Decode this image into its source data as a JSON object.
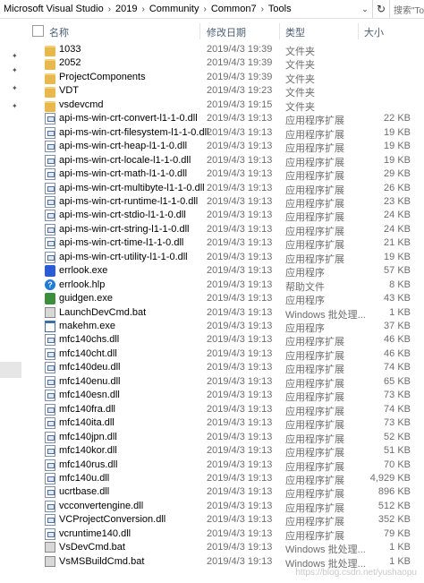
{
  "breadcrumb": [
    "Microsoft Visual Studio",
    "2019",
    "Community",
    "Common7",
    "Tools"
  ],
  "search": {
    "placeholder": "搜索\"To"
  },
  "columns": {
    "name": "名称",
    "date": "修改日期",
    "type": "类型",
    "size": "大小"
  },
  "files": [
    {
      "name": "1033",
      "date": "2019/4/3 19:39",
      "type": "文件夹",
      "size": "",
      "icon": "folder"
    },
    {
      "name": "2052",
      "date": "2019/4/3 19:39",
      "type": "文件夹",
      "size": "",
      "icon": "folder"
    },
    {
      "name": "ProjectComponents",
      "date": "2019/4/3 19:39",
      "type": "文件夹",
      "size": "",
      "icon": "folder"
    },
    {
      "name": "VDT",
      "date": "2019/4/3 19:23",
      "type": "文件夹",
      "size": "",
      "icon": "folder"
    },
    {
      "name": "vsdevcmd",
      "date": "2019/4/3 19:15",
      "type": "文件夹",
      "size": "",
      "icon": "folder"
    },
    {
      "name": "api-ms-win-crt-convert-l1-1-0.dll",
      "date": "2019/4/3 19:13",
      "type": "应用程序扩展",
      "size": "22 KB",
      "icon": "dll"
    },
    {
      "name": "api-ms-win-crt-filesystem-l1-1-0.dll",
      "date": "2019/4/3 19:13",
      "type": "应用程序扩展",
      "size": "19 KB",
      "icon": "dll"
    },
    {
      "name": "api-ms-win-crt-heap-l1-1-0.dll",
      "date": "2019/4/3 19:13",
      "type": "应用程序扩展",
      "size": "19 KB",
      "icon": "dll"
    },
    {
      "name": "api-ms-win-crt-locale-l1-1-0.dll",
      "date": "2019/4/3 19:13",
      "type": "应用程序扩展",
      "size": "19 KB",
      "icon": "dll"
    },
    {
      "name": "api-ms-win-crt-math-l1-1-0.dll",
      "date": "2019/4/3 19:13",
      "type": "应用程序扩展",
      "size": "29 KB",
      "icon": "dll"
    },
    {
      "name": "api-ms-win-crt-multibyte-l1-1-0.dll",
      "date": "2019/4/3 19:13",
      "type": "应用程序扩展",
      "size": "26 KB",
      "icon": "dll"
    },
    {
      "name": "api-ms-win-crt-runtime-l1-1-0.dll",
      "date": "2019/4/3 19:13",
      "type": "应用程序扩展",
      "size": "23 KB",
      "icon": "dll"
    },
    {
      "name": "api-ms-win-crt-stdio-l1-1-0.dll",
      "date": "2019/4/3 19:13",
      "type": "应用程序扩展",
      "size": "24 KB",
      "icon": "dll"
    },
    {
      "name": "api-ms-win-crt-string-l1-1-0.dll",
      "date": "2019/4/3 19:13",
      "type": "应用程序扩展",
      "size": "24 KB",
      "icon": "dll"
    },
    {
      "name": "api-ms-win-crt-time-l1-1-0.dll",
      "date": "2019/4/3 19:13",
      "type": "应用程序扩展",
      "size": "21 KB",
      "icon": "dll"
    },
    {
      "name": "api-ms-win-crt-utility-l1-1-0.dll",
      "date": "2019/4/3 19:13",
      "type": "应用程序扩展",
      "size": "19 KB",
      "icon": "dll"
    },
    {
      "name": "errlook.exe",
      "date": "2019/4/3 19:13",
      "type": "应用程序",
      "size": "57 KB",
      "icon": "exe-blue"
    },
    {
      "name": "errlook.hlp",
      "date": "2019/4/3 19:13",
      "type": "帮助文件",
      "size": "8 KB",
      "icon": "help"
    },
    {
      "name": "guidgen.exe",
      "date": "2019/4/3 19:13",
      "type": "应用程序",
      "size": "43 KB",
      "icon": "guid"
    },
    {
      "name": "LaunchDevCmd.bat",
      "date": "2019/4/3 19:13",
      "type": "Windows 批处理...",
      "size": "1 KB",
      "icon": "bat"
    },
    {
      "name": "makehm.exe",
      "date": "2019/4/3 19:13",
      "type": "应用程序",
      "size": "37 KB",
      "icon": "app"
    },
    {
      "name": "mfc140chs.dll",
      "date": "2019/4/3 19:13",
      "type": "应用程序扩展",
      "size": "46 KB",
      "icon": "dll"
    },
    {
      "name": "mfc140cht.dll",
      "date": "2019/4/3 19:13",
      "type": "应用程序扩展",
      "size": "46 KB",
      "icon": "dll"
    },
    {
      "name": "mfc140deu.dll",
      "date": "2019/4/3 19:13",
      "type": "应用程序扩展",
      "size": "74 KB",
      "icon": "dll"
    },
    {
      "name": "mfc140enu.dll",
      "date": "2019/4/3 19:13",
      "type": "应用程序扩展",
      "size": "65 KB",
      "icon": "dll"
    },
    {
      "name": "mfc140esn.dll",
      "date": "2019/4/3 19:13",
      "type": "应用程序扩展",
      "size": "73 KB",
      "icon": "dll"
    },
    {
      "name": "mfc140fra.dll",
      "date": "2019/4/3 19:13",
      "type": "应用程序扩展",
      "size": "74 KB",
      "icon": "dll"
    },
    {
      "name": "mfc140ita.dll",
      "date": "2019/4/3 19:13",
      "type": "应用程序扩展",
      "size": "73 KB",
      "icon": "dll"
    },
    {
      "name": "mfc140jpn.dll",
      "date": "2019/4/3 19:13",
      "type": "应用程序扩展",
      "size": "52 KB",
      "icon": "dll"
    },
    {
      "name": "mfc140kor.dll",
      "date": "2019/4/3 19:13",
      "type": "应用程序扩展",
      "size": "51 KB",
      "icon": "dll"
    },
    {
      "name": "mfc140rus.dll",
      "date": "2019/4/3 19:13",
      "type": "应用程序扩展",
      "size": "70 KB",
      "icon": "dll"
    },
    {
      "name": "mfc140u.dll",
      "date": "2019/4/3 19:13",
      "type": "应用程序扩展",
      "size": "4,929 KB",
      "icon": "dll"
    },
    {
      "name": "ucrtbase.dll",
      "date": "2019/4/3 19:13",
      "type": "应用程序扩展",
      "size": "896 KB",
      "icon": "dll"
    },
    {
      "name": "vcconvertengine.dll",
      "date": "2019/4/3 19:13",
      "type": "应用程序扩展",
      "size": "512 KB",
      "icon": "dll"
    },
    {
      "name": "VCProjectConversion.dll",
      "date": "2019/4/3 19:13",
      "type": "应用程序扩展",
      "size": "352 KB",
      "icon": "dll"
    },
    {
      "name": "vcruntime140.dll",
      "date": "2019/4/3 19:13",
      "type": "应用程序扩展",
      "size": "79 KB",
      "icon": "dll"
    },
    {
      "name": "VsDevCmd.bat",
      "date": "2019/4/3 19:13",
      "type": "Windows 批处理...",
      "size": "1 KB",
      "icon": "bat"
    },
    {
      "name": "VsMSBuildCmd.bat",
      "date": "2019/4/3 19:13",
      "type": "Windows 批处理...",
      "size": "1 KB",
      "icon": "bat"
    }
  ],
  "watermark": "https://blog.csdn.net/yushaopu"
}
